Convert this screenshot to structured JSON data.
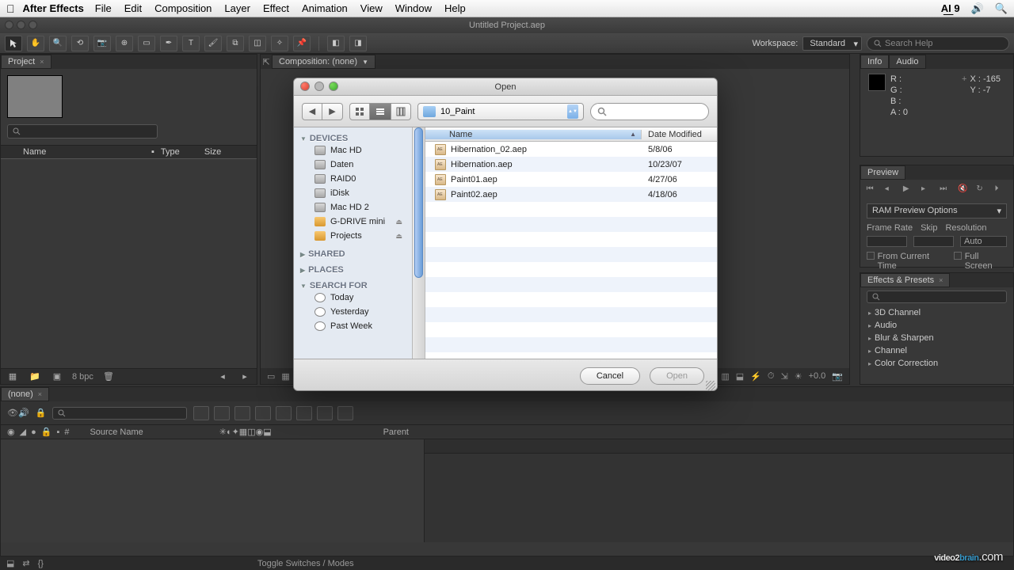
{
  "menubar": {
    "app_name": "After Effects",
    "items": [
      "File",
      "Edit",
      "Composition",
      "Layer",
      "Effect",
      "Animation",
      "View",
      "Window",
      "Help"
    ],
    "right_badge": "9"
  },
  "window_title": "Untitled Project.aep",
  "workspace": {
    "label": "Workspace:",
    "value": "Standard"
  },
  "search_help_placeholder": "Search Help",
  "project_panel": {
    "tab": "Project",
    "columns": [
      "Name",
      "Type",
      "Size"
    ],
    "footer_bpc": "8 bpc"
  },
  "comp_panel": {
    "tab": "Composition: (none)",
    "footer_exposure": "+0.0"
  },
  "info_panel": {
    "tab1": "Info",
    "tab2": "Audio",
    "r": "R :",
    "g": "G :",
    "b": "B :",
    "a": "A : 0",
    "x": "X : -165",
    "y": "Y : -7"
  },
  "preview_panel": {
    "tab": "Preview",
    "options": "RAM Preview Options",
    "labels": [
      "Frame Rate",
      "Skip",
      "Resolution"
    ],
    "auto": "Auto",
    "from_current": "From Current Time",
    "full_screen": "Full Screen"
  },
  "effects_panel": {
    "tab": "Effects & Presets",
    "items": [
      "3D Channel",
      "Audio",
      "Blur & Sharpen",
      "Channel",
      "Color Correction"
    ]
  },
  "timeline": {
    "tab": "(none)",
    "col_hash": "#",
    "col_src": "Source Name",
    "col_parent": "Parent",
    "toggle": "Toggle Switches / Modes"
  },
  "dialog": {
    "title": "Open",
    "path": "10_Paint",
    "sidebar": {
      "devices": "DEVICES",
      "devices_items": [
        "Mac HD",
        "Daten",
        "RAID0",
        "iDisk",
        "Mac HD 2",
        "G-DRIVE mini",
        "Projects"
      ],
      "shared": "SHARED",
      "places": "PLACES",
      "search_for": "SEARCH FOR",
      "search_items": [
        "Today",
        "Yesterday",
        "Past Week"
      ]
    },
    "columns": {
      "name": "Name",
      "date": "Date Modified"
    },
    "files": [
      {
        "name": "Hibernation_02.aep",
        "date": "5/8/06"
      },
      {
        "name": "Hibernation.aep",
        "date": "10/23/07"
      },
      {
        "name": "Paint01.aep",
        "date": "4/27/06"
      },
      {
        "name": "Paint02.aep",
        "date": "4/18/06"
      }
    ],
    "cancel": "Cancel",
    "open": "Open"
  },
  "watermark": {
    "a": "video2",
    "b": "brain",
    "c": ".com"
  }
}
